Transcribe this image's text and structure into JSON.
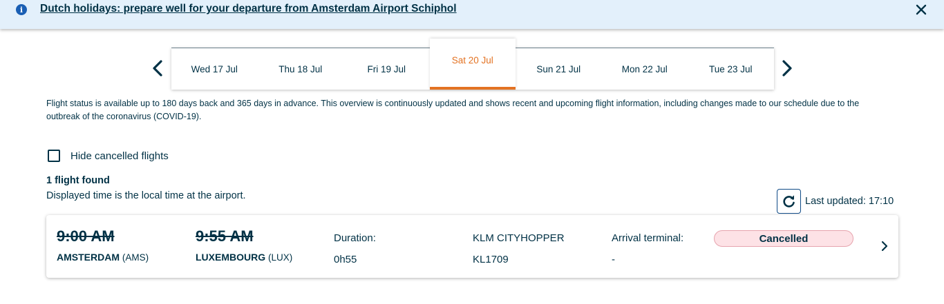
{
  "banner": {
    "link_text": "Dutch holidays: prepare well for your departure from Amsterdam Airport Schiphol",
    "info_icon": "info-icon",
    "close_icon": "close-icon"
  },
  "date_nav": {
    "prev_icon": "chevron-left-icon",
    "next_icon": "chevron-right-icon",
    "tabs": [
      {
        "label": "Wed 17 Jul"
      },
      {
        "label": "Thu 18 Jul"
      },
      {
        "label": "Fri 19 Jul"
      },
      {
        "label": "Sat 20 Jul",
        "selected": true
      },
      {
        "label": "Sun 21 Jul"
      },
      {
        "label": "Mon 22 Jul"
      },
      {
        "label": "Tue 23 Jul"
      }
    ]
  },
  "info_text": "Flight status is available up to 180 days back and 365 days in advance. This overview is continuously updated and shows recent and upcoming flight information, including changes made to our schedule due to the outbreak of the coronavirus (COVID-19).",
  "filter": {
    "hide_cancelled_label": "Hide cancelled flights",
    "checked": false
  },
  "results": {
    "count_text": "1 flight found",
    "local_time_note": "Displayed time is the local time at the airport.",
    "last_updated": "Last updated: 17:10",
    "refresh_icon": "refresh-icon"
  },
  "flight": {
    "departure_time": "9:00 AM",
    "departure_city": "AMSTERDAM",
    "departure_code": "(AMS)",
    "arrival_time": "9:55 AM",
    "arrival_city": "LUXEMBOURG",
    "arrival_code": "(LUX)",
    "duration_label": "Duration:",
    "duration_value": "0h55",
    "carrier": "KLM CITYHOPPER",
    "flight_number": "KL1709",
    "terminal_label": "Arrival terminal:",
    "terminal_value": "-",
    "status": "Cancelled"
  },
  "colors": {
    "accent": "#e37222",
    "text": "#003145",
    "banner_bg": "#e3f0fb",
    "cancelled_bg": "#fde2e6"
  }
}
